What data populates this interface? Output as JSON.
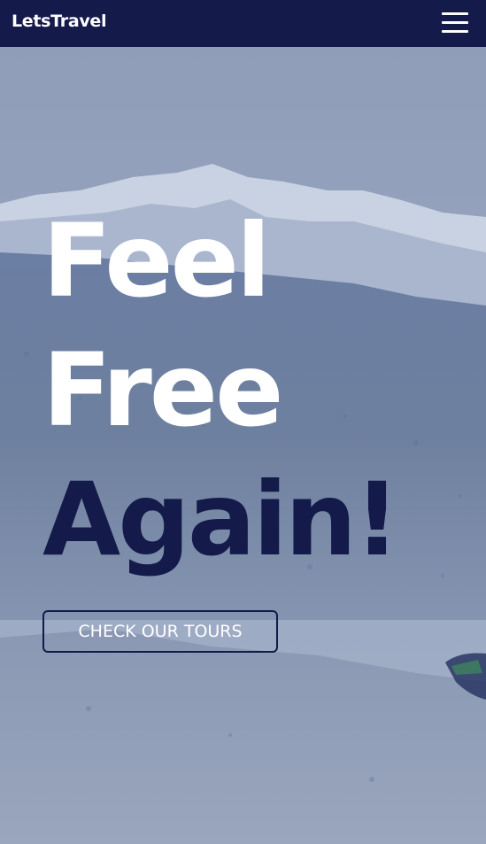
{
  "navbar": {
    "brand": "LetsTravel",
    "menu_icon": "hamburger-menu-icon"
  },
  "hero": {
    "line1": "Feel",
    "line2": "Free",
    "line3": "Again!",
    "cta_label": "CHECK OUR TOURS"
  },
  "colors": {
    "navy": "#141a4a",
    "white": "#ffffff",
    "sky": "#7d8fb0"
  }
}
